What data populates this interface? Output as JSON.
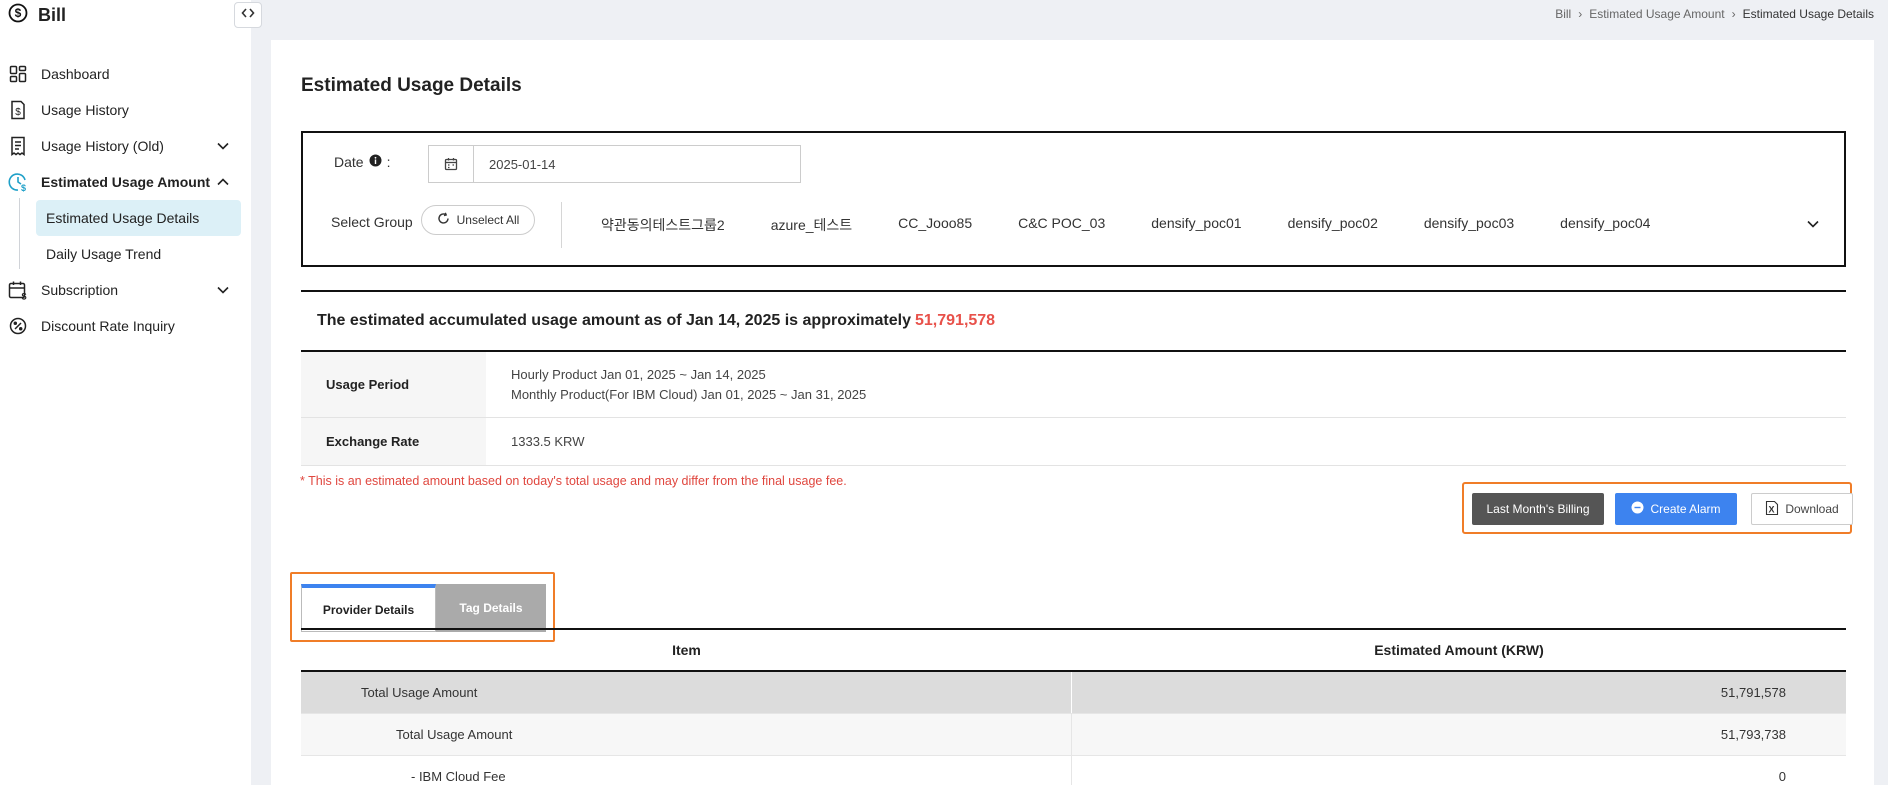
{
  "app": {
    "title": "Bill"
  },
  "sidebar": {
    "items": [
      {
        "label": "Dashboard",
        "icon": "dashboard-icon"
      },
      {
        "label": "Usage History",
        "icon": "receipt-dollar-icon"
      },
      {
        "label": "Usage History (Old)",
        "icon": "receipt-icon"
      },
      {
        "label": "Estimated Usage Amount",
        "icon": "clock-dollar-icon"
      },
      {
        "label": "Subscription",
        "icon": "calendar-dollar-icon"
      },
      {
        "label": "Discount Rate Inquiry",
        "icon": "percent-icon"
      }
    ],
    "sub_items": [
      {
        "label": "Estimated Usage Details"
      },
      {
        "label": "Daily Usage Trend"
      }
    ]
  },
  "breadcrumb": [
    "Bill",
    "Estimated Usage Amount",
    "Estimated Usage Details"
  ],
  "page": {
    "title": "Estimated Usage Details"
  },
  "filter": {
    "date_label": "Date",
    "date_colon": ":",
    "date_value": "2025-01-14",
    "group_label": "Select Group",
    "unselect_label": "Unselect All",
    "groups": [
      "약관동의테스트그룹2",
      "azure_테스트",
      "CC_Jooo85",
      "C&C POC_03",
      "densify_poc01",
      "densify_poc02",
      "densify_poc03",
      "densify_poc04"
    ]
  },
  "summary": {
    "text": "The estimated accumulated usage amount as of Jan 14, 2025 is approximately",
    "amount": "51,791,578"
  },
  "info": {
    "usage_period_label": "Usage Period",
    "usage_period_line1": "Hourly Product Jan 01, 2025 ~ Jan 14, 2025",
    "usage_period_line2": "Monthly Product(For IBM Cloud) Jan 01, 2025 ~ Jan 31, 2025",
    "exchange_rate_label": "Exchange Rate",
    "exchange_rate_value": "1333.5 KRW"
  },
  "notice": "* This is an estimated amount based on today's total usage and may differ from the final usage fee.",
  "actions": {
    "last_month": "Last Month's Billing",
    "create_alarm": "Create Alarm",
    "download": "Download"
  },
  "tabs": {
    "provider": "Provider Details",
    "tag": "Tag Details"
  },
  "table": {
    "headers": [
      "Item",
      "Estimated Amount (KRW)"
    ],
    "rows": [
      {
        "item": "Total Usage Amount",
        "amount": "51,791,578"
      },
      {
        "item": "Total Usage Amount",
        "amount": "51,793,738"
      },
      {
        "item": "- IBM Cloud Fee",
        "amount": "0"
      }
    ]
  },
  "colors": {
    "accent": "#3d83ef",
    "highlight_amount": "#e8514a",
    "annotation_box": "#f07d28",
    "active_sub_bg": "#dcf0f7"
  }
}
